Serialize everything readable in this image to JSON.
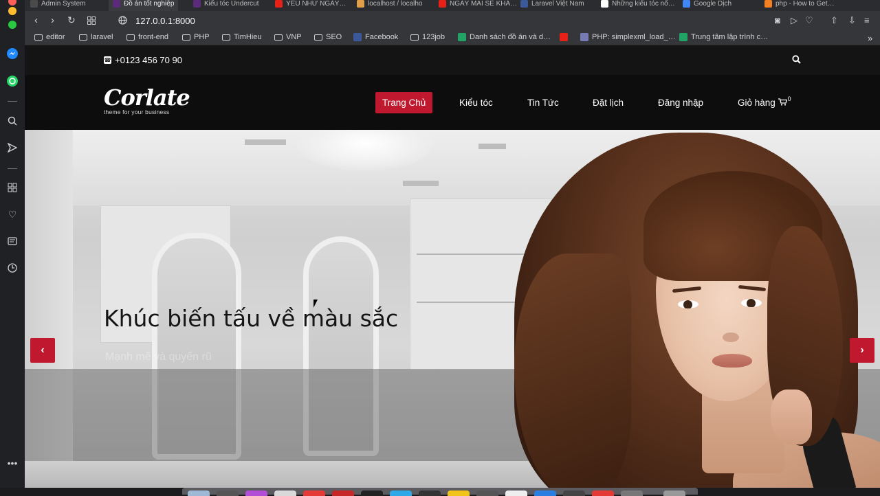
{
  "browser": {
    "tabs": [
      {
        "title": "Admin System",
        "color": "#4a4a4a"
      },
      {
        "title": "Đồ án tốt nghiệp",
        "color": "#5b2a7a",
        "active": true
      },
      {
        "title": "Kiểu tóc Undercut",
        "color": "#5b2a7a"
      },
      {
        "title": "YÊU NHƯ NGÀY…",
        "color": "#e62117"
      },
      {
        "title": "localhost / localho",
        "color": "#e0a04a"
      },
      {
        "title": "NGÀY MAI SẼ KHÁ…",
        "color": "#e62117"
      },
      {
        "title": "Laravel Việt Nam",
        "color": "#3b5998"
      },
      {
        "title": "Những kiểu tóc nổ…",
        "color": "#ffffff"
      },
      {
        "title": "Google Dịch",
        "color": "#4285f4"
      },
      {
        "title": "php - How to Get…",
        "color": "#f48024"
      }
    ],
    "url": "127.0.0.1:8000",
    "bookmarks": [
      {
        "label": "editor",
        "type": "folder"
      },
      {
        "label": "laravel",
        "type": "folder"
      },
      {
        "label": "front-end",
        "type": "folder"
      },
      {
        "label": "PHP",
        "type": "folder"
      },
      {
        "label": "TimHieu",
        "type": "folder"
      },
      {
        "label": "VNP",
        "type": "folder"
      },
      {
        "label": "SEO",
        "type": "folder"
      },
      {
        "label": "Facebook",
        "type": "site",
        "color": "#3b5998"
      },
      {
        "label": "123job",
        "type": "folder"
      },
      {
        "label": "Danh sách đồ án và d…",
        "type": "site",
        "color": "#21a366"
      },
      {
        "label": "",
        "type": "site",
        "color": "#e62117"
      },
      {
        "label": "PHP: simplexml_load_…",
        "type": "site",
        "color": "#777bb3"
      },
      {
        "label": "Trung tâm lập trình c…",
        "type": "site",
        "color": "#21a366"
      }
    ]
  },
  "site": {
    "phone": "+0123 456 70 90",
    "logo": {
      "word": "Corlate",
      "tagline": "theme for your business"
    },
    "menu": [
      {
        "label": "Trang Chủ",
        "active": true
      },
      {
        "label": "Kiểu tóc"
      },
      {
        "label": "Tin Tức"
      },
      {
        "label": "Đặt lịch"
      },
      {
        "label": "Đăng nhập"
      },
      {
        "label": "Giỏ hàng"
      }
    ],
    "cart_count": "0",
    "hero": {
      "title": "Khúc biến tấu về màu sắc",
      "subtitle": "Mạnh mẽ và quyến rũ"
    }
  },
  "colors": {
    "accent": "#c0182e",
    "topbar": "#141414",
    "nav": "#0d0d0d"
  }
}
